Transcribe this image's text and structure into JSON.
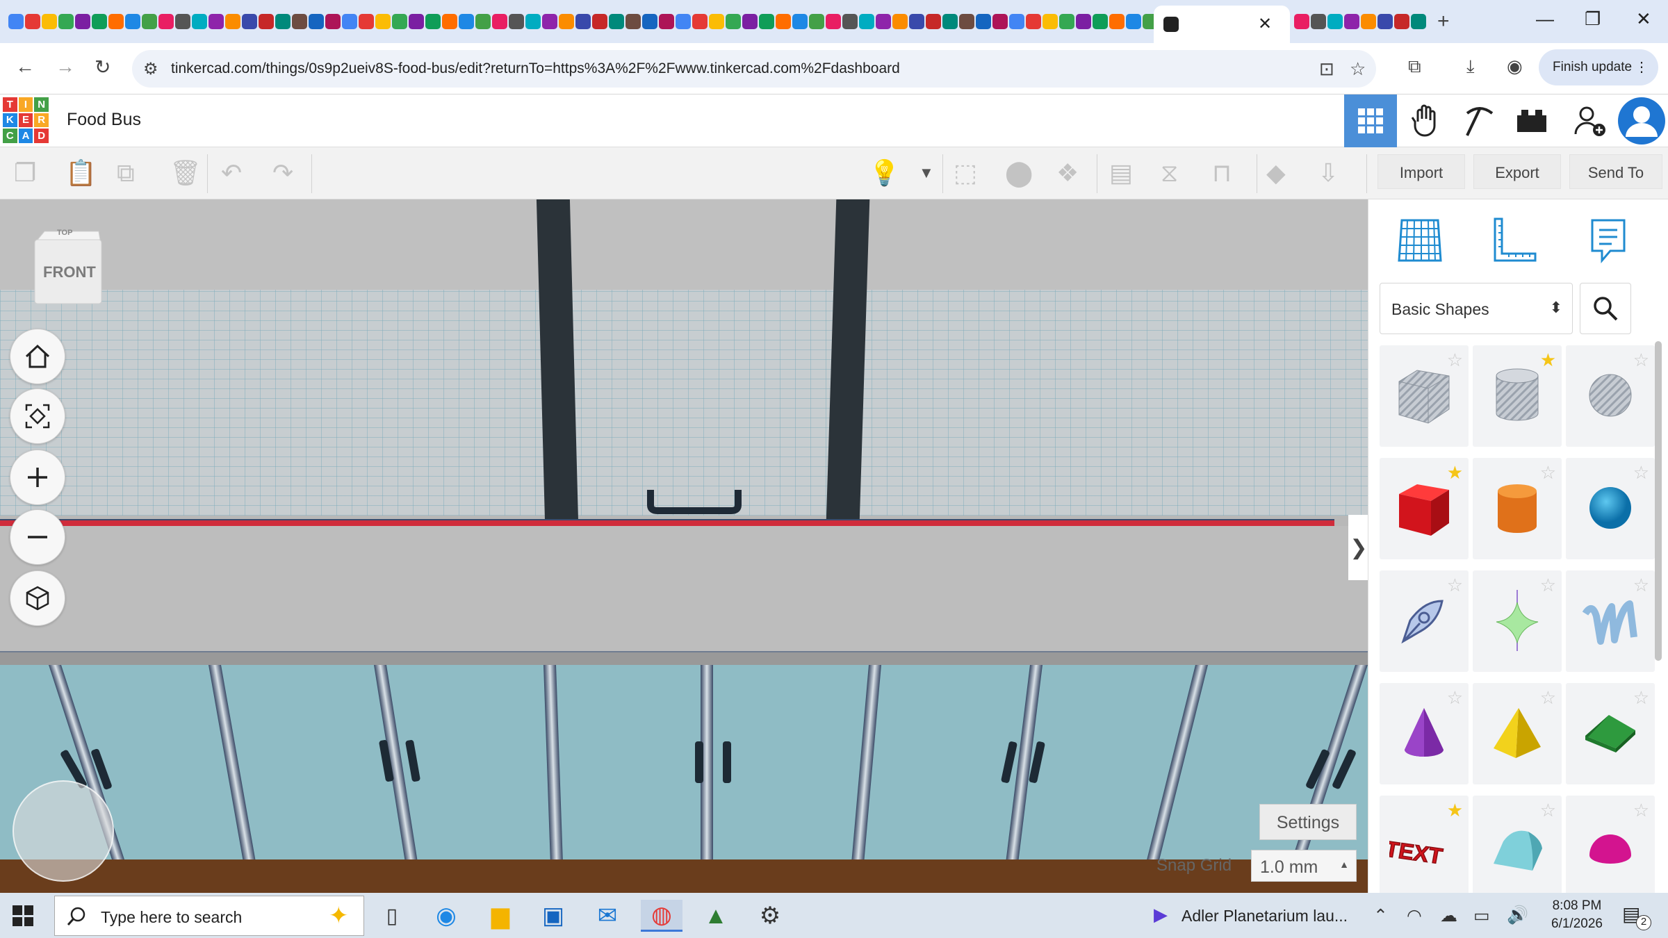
{
  "browser": {
    "tab_close": "✕",
    "new_tab": "+",
    "window_controls": {
      "minimize": "—",
      "restore": "❐",
      "close": "✕"
    },
    "nav": {
      "back": "←",
      "forward": "→",
      "reload": "↻"
    },
    "url": "tinkercad.com/things/0s9p2ueiv8S-food-bus/edit?returnTo=https%3A%2F%2Fwww.tinkercad.com%2Fdashboard",
    "finish_update": "Finish update",
    "favicon_colors": [
      "#4285f4",
      "#e53935",
      "#fbbc05",
      "#34a853",
      "#7b1fa2",
      "#0f9d58",
      "#ff6d00",
      "#1e88e5",
      "#43a047",
      "#e91e63",
      "#555555",
      "#00acc1",
      "#8e24aa",
      "#fb8c00",
      "#3949ab",
      "#c62828",
      "#00897b",
      "#6d4c41",
      "#1565c0",
      "#ad1457"
    ]
  },
  "app": {
    "logo_letters": [
      "T",
      "I",
      "N",
      "K",
      "E",
      "R",
      "C",
      "A",
      "D"
    ],
    "logo_colors": [
      "#e53935",
      "#f9a825",
      "#43a047",
      "#1e88e5",
      "#e53935",
      "#f9a825",
      "#43a047",
      "#1e88e5",
      "#e53935"
    ],
    "design_title": "Food Bus",
    "header_icons": [
      "grid-view-icon",
      "hand-icon",
      "pickaxe-icon",
      "brick-icon",
      "add-user-icon",
      "avatar"
    ]
  },
  "toolbar": {
    "import": "Import",
    "export": "Export",
    "send_to": "Send To"
  },
  "viewport": {
    "viewcube_top": "TOP",
    "viewcube_front": "FRONT",
    "settings": "Settings",
    "snap_grid_label": "Snap Grid",
    "snap_grid_value": "1.0 mm",
    "collapse": "❯"
  },
  "shapes_panel": {
    "category": "Basic Shapes",
    "shapes": [
      {
        "name": "box-hole",
        "starred": false
      },
      {
        "name": "cylinder-hole",
        "starred": true
      },
      {
        "name": "sphere-hole",
        "starred": false
      },
      {
        "name": "box",
        "starred": true
      },
      {
        "name": "cylinder",
        "starred": false
      },
      {
        "name": "sphere",
        "starred": false
      },
      {
        "name": "scribble",
        "starred": false
      },
      {
        "name": "shape-generator",
        "starred": false
      },
      {
        "name": "text-scribble",
        "starred": false
      },
      {
        "name": "cone",
        "starred": false
      },
      {
        "name": "pyramid",
        "starred": false
      },
      {
        "name": "roof",
        "starred": false
      },
      {
        "name": "text",
        "starred": true
      },
      {
        "name": "round-roof",
        "starred": false
      },
      {
        "name": "half-sphere",
        "starred": false
      }
    ],
    "text_shape_label": "TEXT"
  },
  "taskbar": {
    "search_placeholder": "Type here to search",
    "notification": "Adler Planetarium lau...",
    "time": "8:08 PM",
    "date": "6/1/2026",
    "badge": "2"
  }
}
